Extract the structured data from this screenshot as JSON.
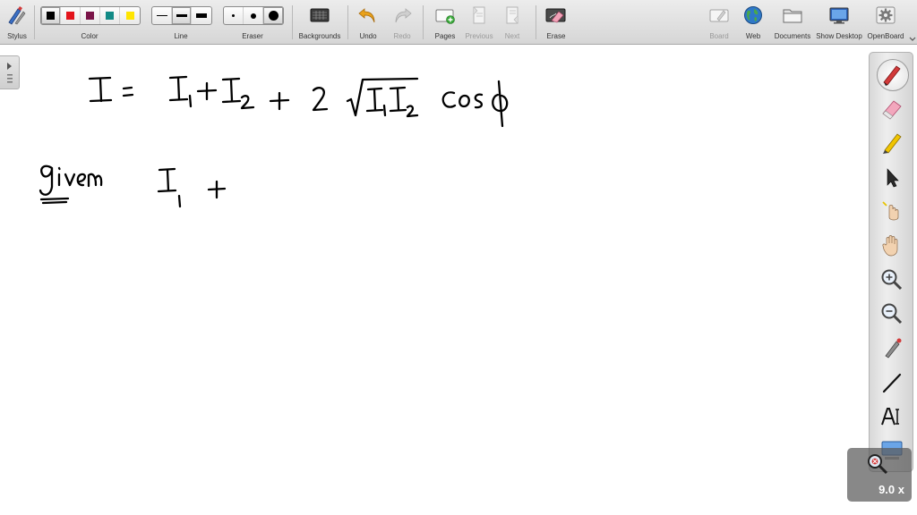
{
  "toolbar": {
    "stylus_label": "Stylus",
    "color_label": "Color",
    "line_label": "Line",
    "eraser_label": "Eraser",
    "backgrounds_label": "Backgrounds",
    "undo_label": "Undo",
    "redo_label": "Redo",
    "pages_label": "Pages",
    "previous_label": "Previous",
    "next_label": "Next",
    "erase_label": "Erase",
    "board_label": "Board",
    "web_label": "Web",
    "documents_label": "Documents",
    "show_desktop_label": "Show Desktop",
    "openboard_label": "OpenBoard"
  },
  "colors": [
    "#000000",
    "#e3141b",
    "#7a1448",
    "#128a86",
    "#ffe500"
  ],
  "selected_color": "#000000",
  "zoom": {
    "value": "9.0 x"
  },
  "board": {
    "equation_description": "handwritten: I = I1 + I2 + 2 sqrt(I1 I2) cos phi",
    "given_line": "handwritten: given I1 +"
  },
  "dock_tools": [
    "pen-icon",
    "eraser-icon",
    "highlighter-icon",
    "pointer-icon",
    "laser-pointer-icon",
    "hand-icon",
    "zoom-in-icon",
    "zoom-out-icon",
    "capture-icon",
    "line-icon",
    "text-icon",
    "capture-screen-icon"
  ]
}
